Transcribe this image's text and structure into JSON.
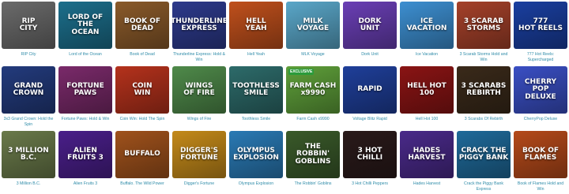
{
  "rows": [
    [
      {
        "title": "RIP City",
        "art": "RIP\nCITY",
        "bg": "#6b6b6b"
      },
      {
        "title": "Lord of the Ocean",
        "art": "LORD OF THE\nOCEAN",
        "bg": "#1c6f8c"
      },
      {
        "title": "Book of Dead",
        "art": "BOOK OF\nDEAD",
        "bg": "#8a5a2a"
      },
      {
        "title": "Thunderline Express: Hold & Win",
        "art": "THUNDERLINE\nEXPRESS",
        "bg": "#2d3a8c"
      },
      {
        "title": "Hell Yeah",
        "art": "HELL\nYEAH",
        "bg": "#c0501c"
      },
      {
        "title": "MLK Voyage",
        "art": "MILK\nVOYAGE",
        "bg": "#5aa7c9"
      },
      {
        "title": "Dork Unit",
        "art": "DORK\nUNIT",
        "bg": "#6a3fb5"
      },
      {
        "title": "Ice Vacation",
        "art": "ICE\nVACATION",
        "bg": "#3d8fd1"
      },
      {
        "title": "3 Scarab Storms Hold and Win",
        "art": "3 SCARAB\nSTORMS",
        "bg": "#a5412a"
      },
      {
        "title": "777 Hot Reels: Supercharged",
        "art": "777\nHOT REELS",
        "bg": "#1a3fa0"
      }
    ],
    [
      {
        "title": "3x3 Grand Crown: Hold the Spin",
        "art": "GRAND\nCROWN",
        "bg": "#233b7d"
      },
      {
        "title": "Fortune Paws: Hold & Win",
        "art": "FORTUNE\nPAWS",
        "bg": "#7a2a6a"
      },
      {
        "title": "Coin Win: Hold The Spin",
        "art": "COIN\nWIN",
        "bg": "#b5321c"
      },
      {
        "title": "Wings of Fire",
        "art": "WINGS\nOF FIRE",
        "bg": "#4f8a4a"
      },
      {
        "title": "Toothless Smile",
        "art": "TOOTHLESS\nSMILE",
        "bg": "#2d6b6a"
      },
      {
        "title": "Farm Cash x9990",
        "art": "FARM CASH\nx9990",
        "bg": "#5fa03a",
        "badge": "EXCLUSIVE"
      },
      {
        "title": "Voltage Blitz Rapid",
        "art": "RAPID",
        "bg": "#1f3f9a"
      },
      {
        "title": "Hell Hot 100",
        "art": "HELL HOT\n100",
        "bg": "#8a1414"
      },
      {
        "title": "3 Scarabs Of Rebirth",
        "art": "3 SCARABS\nREBIRTH",
        "bg": "#3a2a1a"
      },
      {
        "title": "CherryPop Deluxe",
        "art": "CHERRY POP\nDELUXE",
        "bg": "#3a4fc4"
      }
    ],
    [
      {
        "title": "3 Million B.C.",
        "art": "3 MILLION\nB.C.",
        "bg": "#6a7a4a"
      },
      {
        "title": "Alien Fruits 3",
        "art": "ALIEN\nFRUITS 3",
        "bg": "#4a1f8a"
      },
      {
        "title": "Buffalo. The Wild Power",
        "art": "BUFFALO",
        "bg": "#a0521c"
      },
      {
        "title": "Digger's Fortune",
        "art": "DIGGER'S\nFORTUNE",
        "bg": "#c48a1a"
      },
      {
        "title": "Olympus Explosion",
        "art": "OLYMPUS\nEXPLOSION",
        "bg": "#2a7ab5"
      },
      {
        "title": "The Robbin' Goblins",
        "art": "THE ROBBIN'\nGOBLINS",
        "bg": "#3a5a2a"
      },
      {
        "title": "3 Hot Chilli Peppers",
        "art": "3 HOT\nCHILLI",
        "bg": "#2a1a1a"
      },
      {
        "title": "Hades Harvest",
        "art": "HADES\nHARVEST",
        "bg": "#4a2a8a"
      },
      {
        "title": "Crack the Piggy Bank Express",
        "art": "CRACK THE\nPIGGY BANK",
        "bg": "#1f6a9a"
      },
      {
        "title": "Book of Flames Hold and Win",
        "art": "BOOK OF\nFLAMES",
        "bg": "#b54a1a"
      }
    ]
  ]
}
